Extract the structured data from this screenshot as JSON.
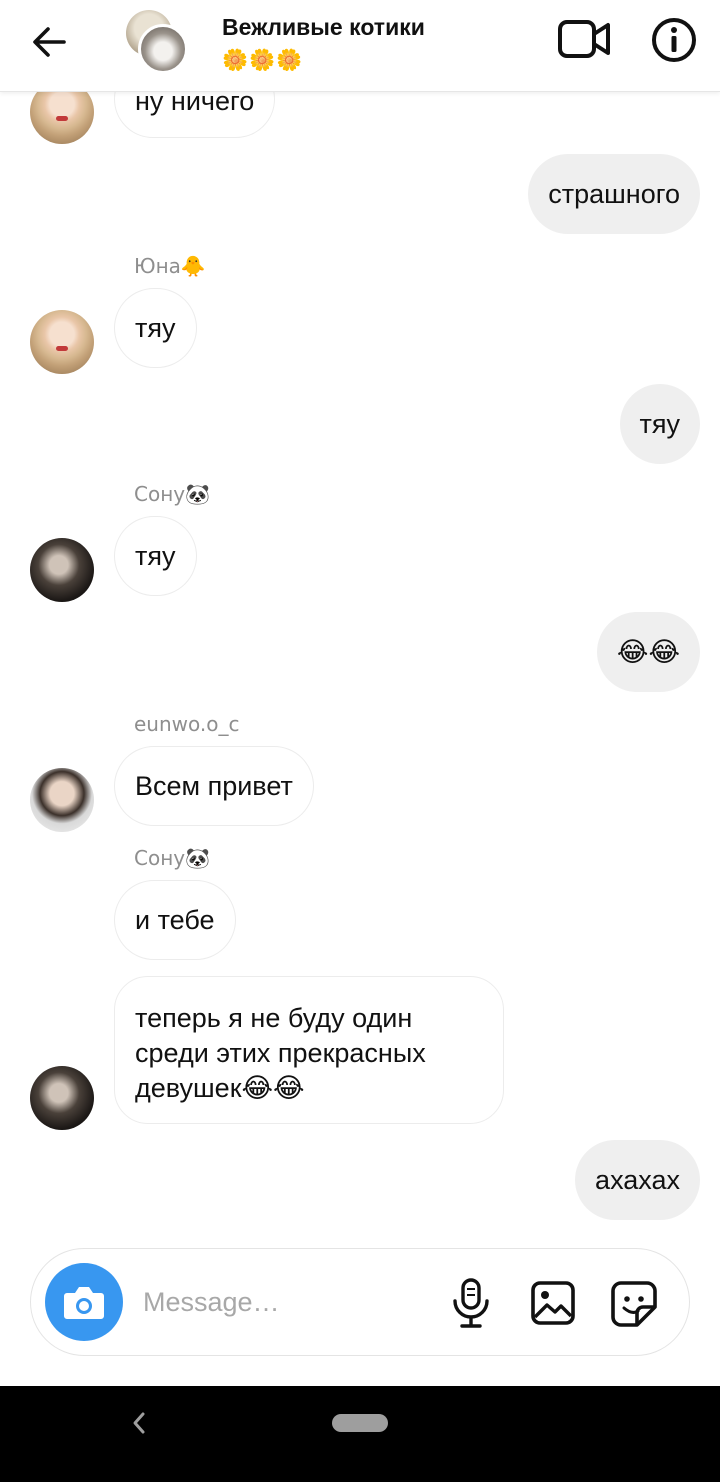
{
  "header": {
    "title": "Вежливые котики",
    "subtitle": "🌼🌼🌼"
  },
  "messages": [
    {
      "side": "in",
      "text": "ну ничего"
    },
    {
      "side": "out",
      "text": "страшного"
    },
    {
      "side": "in",
      "sender": "Юна🐥",
      "text": "тяу"
    },
    {
      "side": "out",
      "text": "тяу"
    },
    {
      "side": "in",
      "sender": "Сону🐼",
      "text": "тяу"
    },
    {
      "side": "out",
      "text": "😂😂"
    },
    {
      "side": "in",
      "sender": "eunwo.o_c",
      "text": "Всем привет"
    },
    {
      "side": "in",
      "sender": "Сону🐼",
      "text": "и тебе"
    },
    {
      "side": "in",
      "text": "теперь я не буду один среди этих прекрасных девушек😂😂"
    },
    {
      "side": "out",
      "text": "ахахах"
    }
  ],
  "composer": {
    "placeholder": "Message…"
  },
  "icons": {
    "back": "arrow-left-icon",
    "video": "video-camera-icon",
    "info": "info-icon",
    "camera": "camera-icon",
    "mic": "microphone-icon",
    "gallery": "image-icon",
    "sticker": "sticker-icon"
  },
  "colors": {
    "accent": "#3897f0",
    "incoming_bubble": "#ffffff",
    "outgoing_bubble": "#efefef"
  }
}
